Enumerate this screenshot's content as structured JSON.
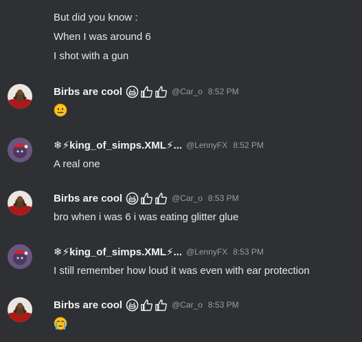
{
  "intro_lines": [
    "But did you know :",
    "When I was around 6",
    "I shot with a gun"
  ],
  "users": {
    "birbs": {
      "name": "Birbs are cool",
      "handle": "@Car_o"
    },
    "king": {
      "name": "❄⚡king_of_simps.XML⚡...",
      "handle": "@LennyFX"
    }
  },
  "messages": [
    {
      "user": "birbs",
      "time": "8:52 PM",
      "text": "",
      "emoji": "neutral-face"
    },
    {
      "user": "king",
      "time": "8:52 PM",
      "text": "A real one"
    },
    {
      "user": "birbs",
      "time": "8:53 PM",
      "text": "bro when i was 6 i was eating glitter glue"
    },
    {
      "user": "king",
      "time": "8:53 PM",
      "text": "I still remember how loud it was even with ear protection"
    },
    {
      "user": "birbs",
      "time": "8:53 PM",
      "text": "",
      "emoji": "crying-face"
    }
  ],
  "colors": {
    "background": "#2f3033",
    "text": "#e6e7e9",
    "muted": "#9a9ca2"
  }
}
